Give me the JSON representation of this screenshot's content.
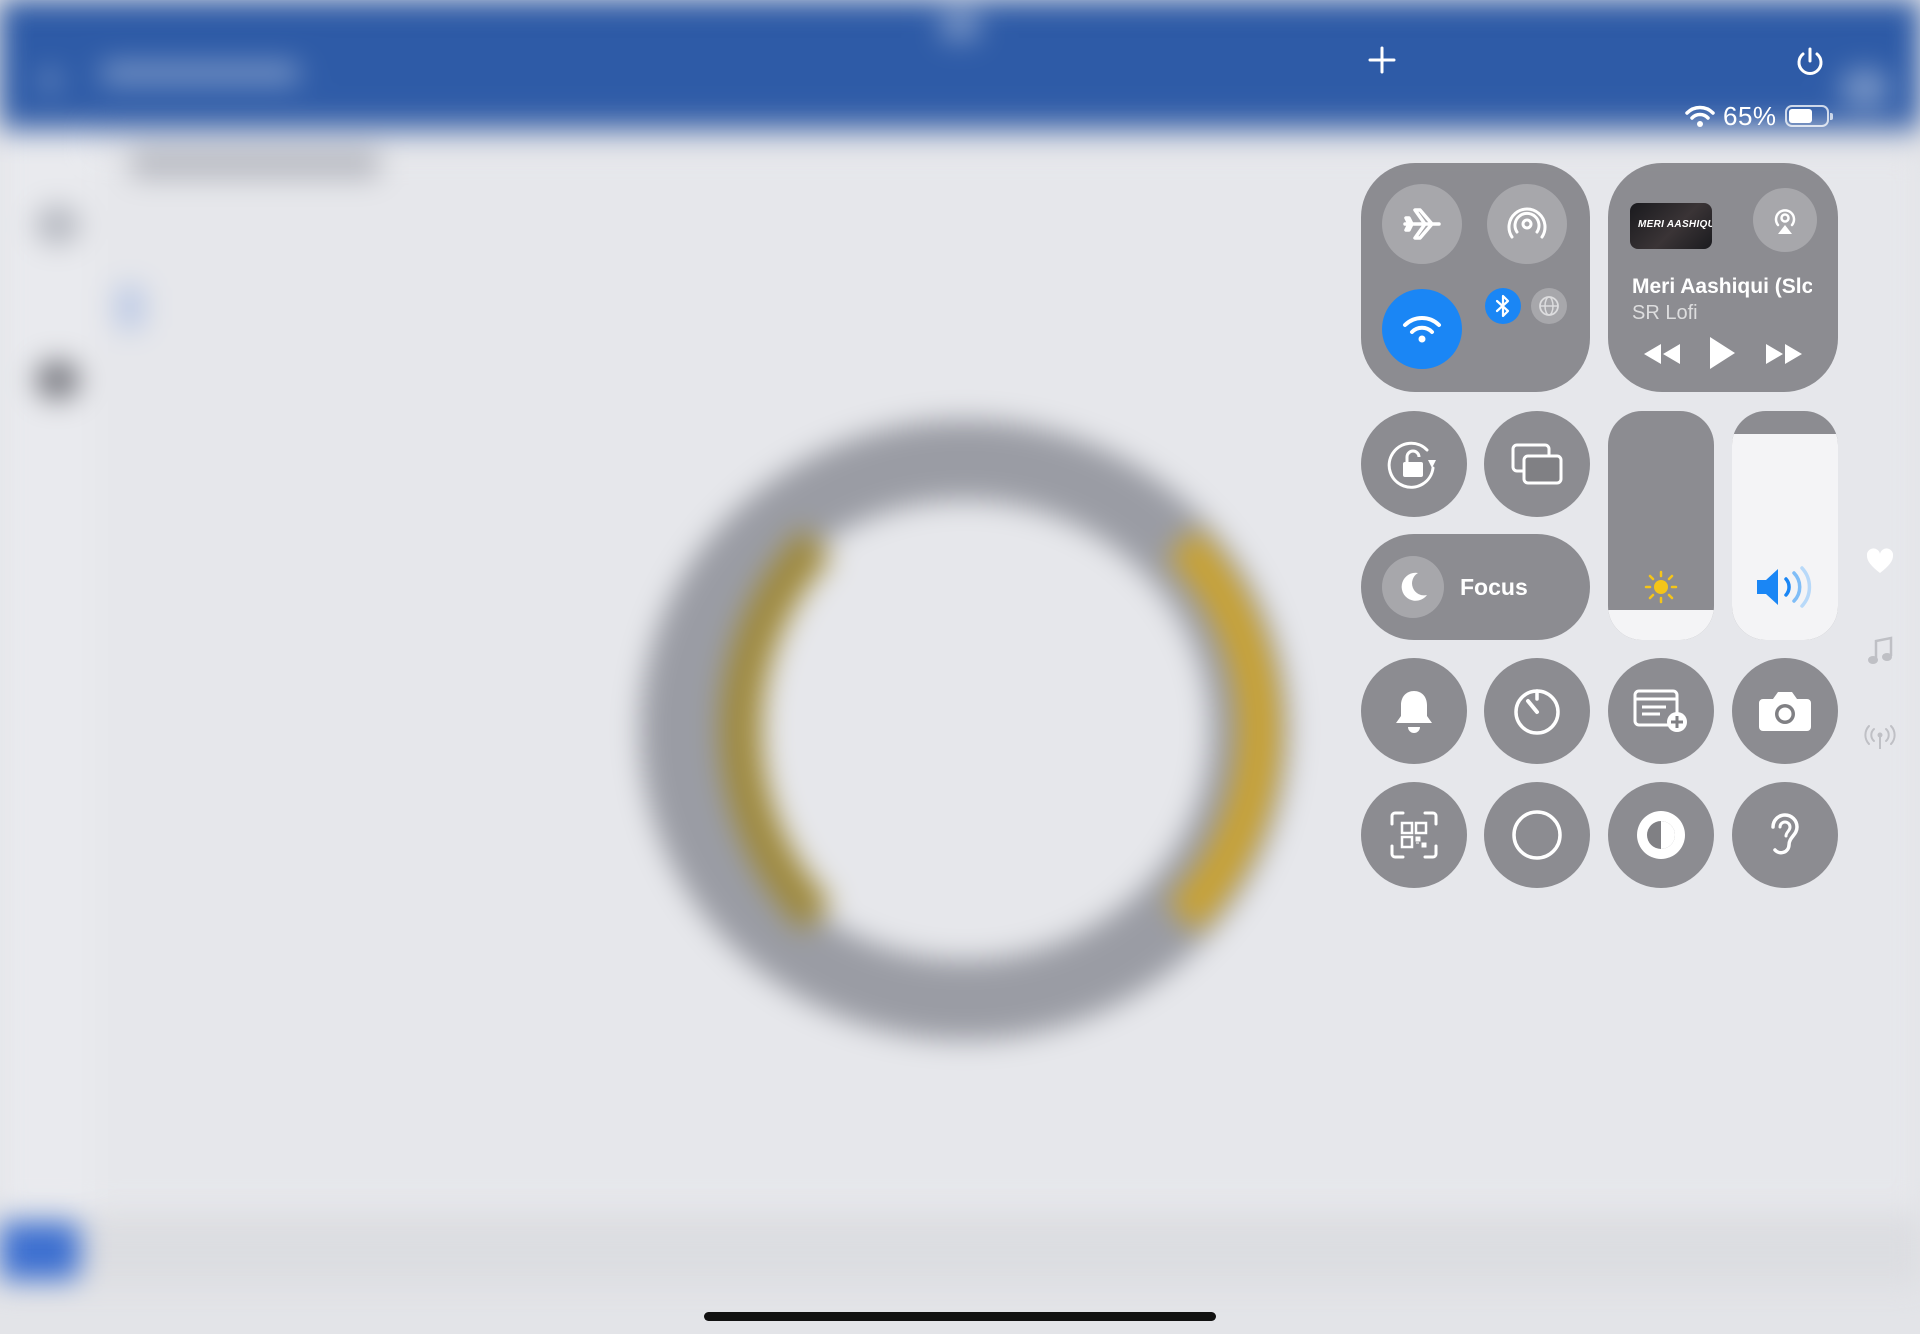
{
  "status_bar": {
    "battery_percent_label": "65%",
    "battery_level": 0.65,
    "wifi": "wifi-icon"
  },
  "control_center": {
    "top_actions": [
      "plus-icon",
      "power-icon"
    ],
    "connectivity": {
      "airplane_mode": {
        "icon": "airplane-icon",
        "active": false
      },
      "airdrop": {
        "icon": "airdrop-icon",
        "active": false
      },
      "wifi": {
        "icon": "wifi-icon",
        "active": true
      },
      "bluetooth": {
        "icon": "bluetooth-icon",
        "active": true
      },
      "vpn": {
        "icon": "globe-icon",
        "active": false
      }
    },
    "now_playing": {
      "artwork_text": "MERI AASHIQUI",
      "title": "Meri Aashiqui (Slc",
      "artist": "SR Lofi",
      "controls": [
        "rewind-icon",
        "play-icon",
        "fast-forward-icon"
      ]
    },
    "focus": {
      "label": "Focus",
      "icon": "moon-icon"
    },
    "brightness": {
      "level": 0.13
    },
    "volume": {
      "level": 0.9
    },
    "accent_color": "#1a86f5",
    "toggles": [
      "rotation-lock-icon",
      "screen-mirroring-icon",
      "bell-icon",
      "timer-icon",
      "quick-note-icon",
      "camera-icon",
      "qr-scanner-icon",
      "screen-record-icon",
      "dark-mode-icon",
      "hearing-icon"
    ]
  },
  "side_indicators": [
    "heart-icon",
    "music-icon",
    "broadcast-icon"
  ]
}
